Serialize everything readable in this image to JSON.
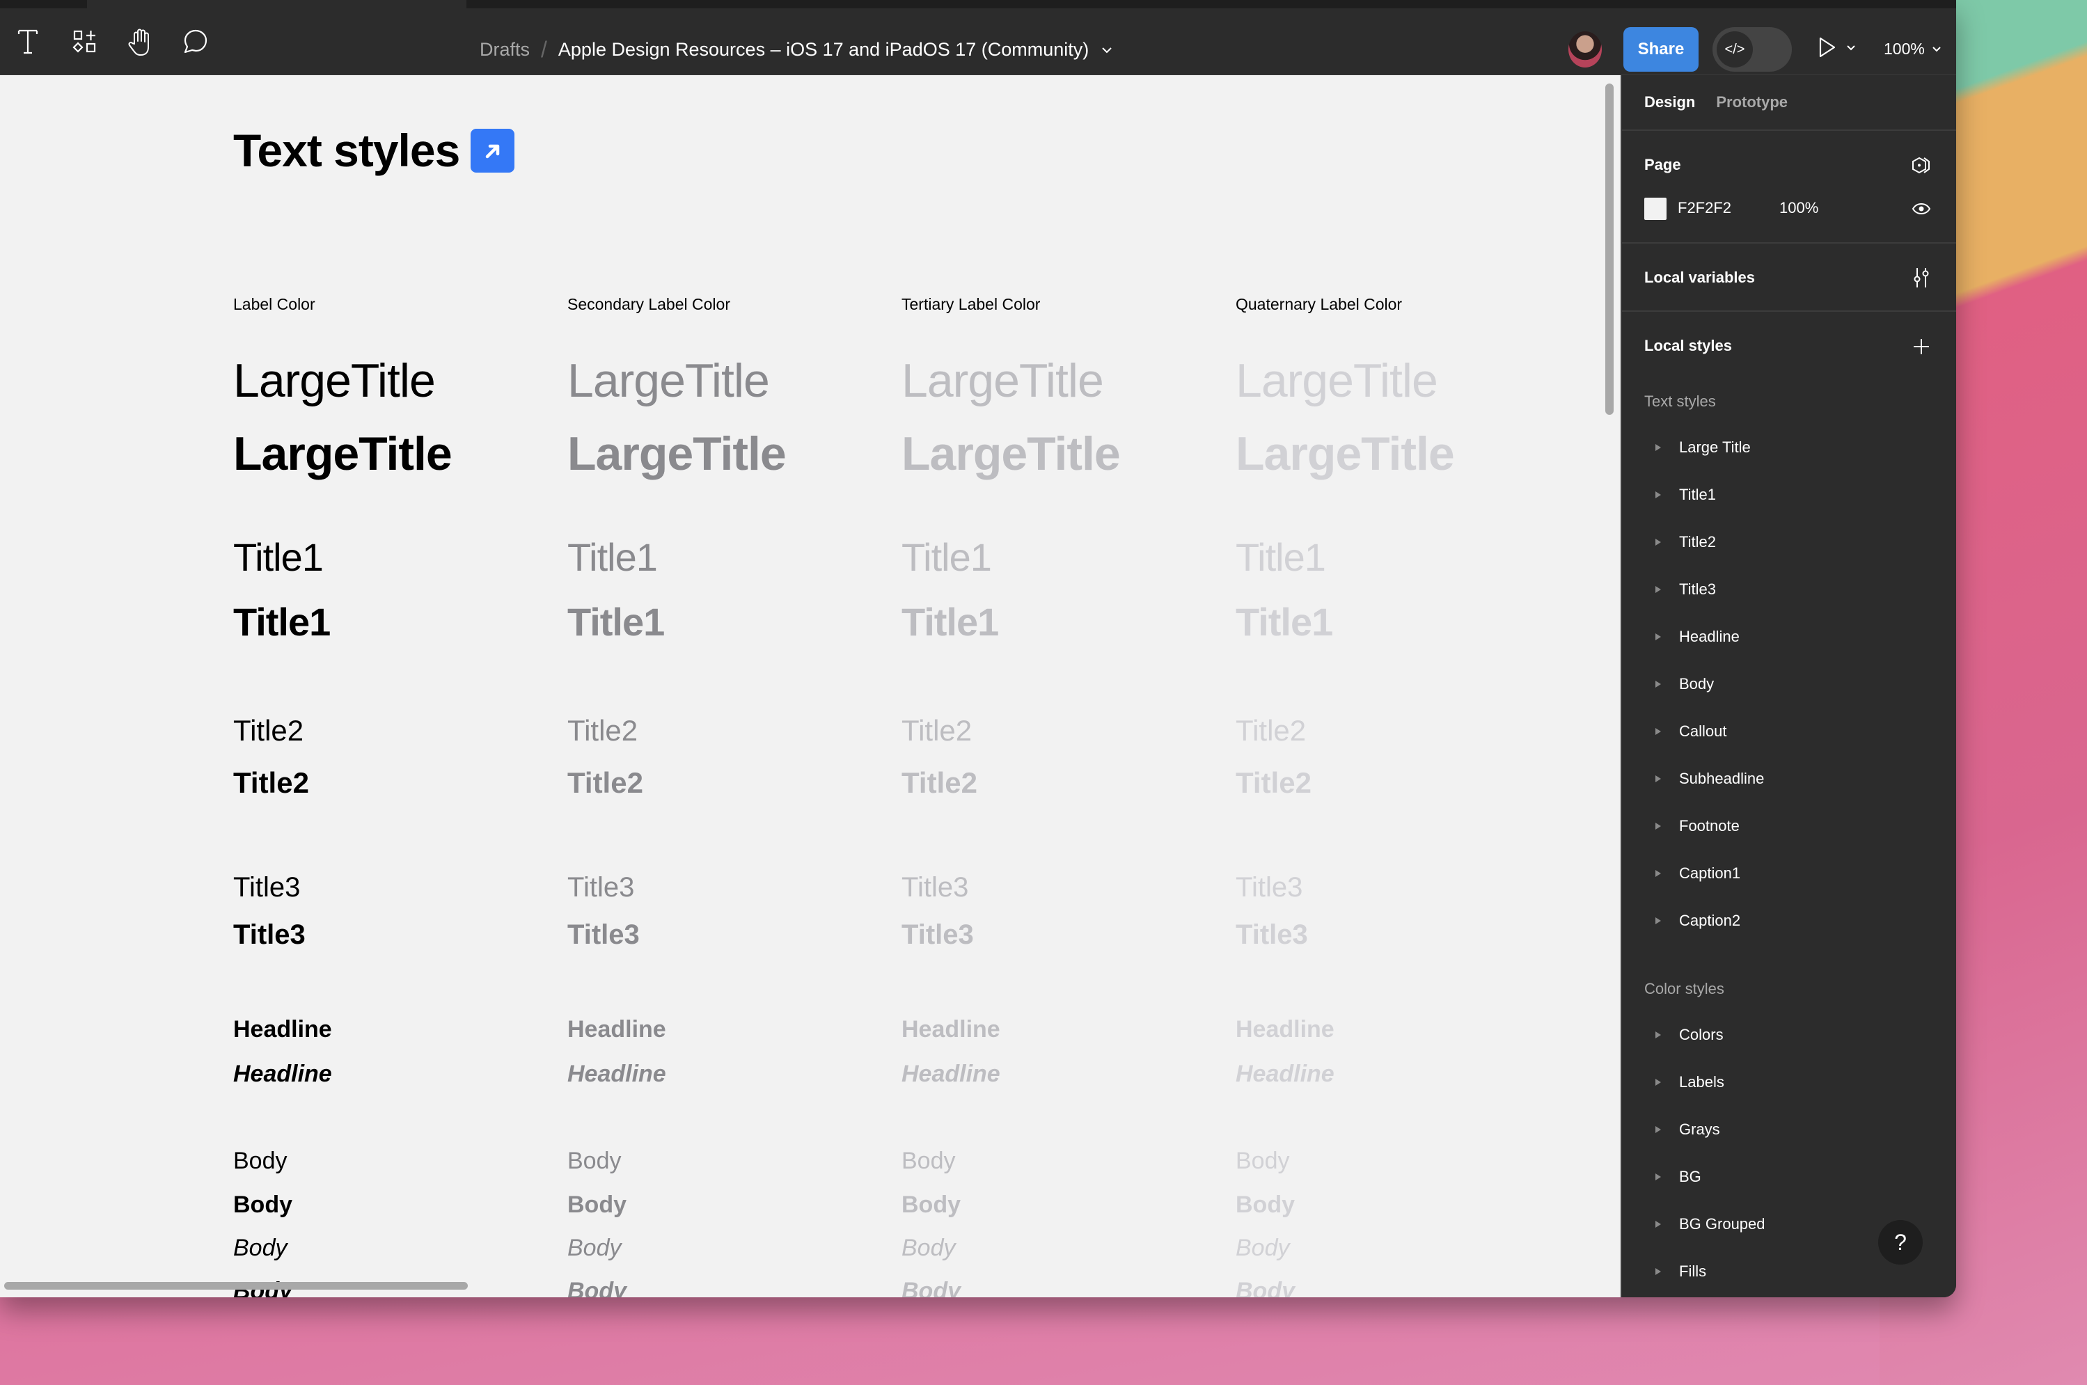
{
  "toolbar": {
    "tools": [
      {
        "name": "text-tool",
        "icon": "text-T-icon"
      },
      {
        "name": "resources-tool",
        "icon": "shapes-plus-icon"
      },
      {
        "name": "hand-tool",
        "icon": "hand-icon"
      },
      {
        "name": "comment-tool",
        "icon": "speech-bubble-icon"
      }
    ],
    "breadcrumb": {
      "parent": "Drafts",
      "separator": "/",
      "file_name": "Apple Design Resources – iOS 17 and iPadOS 17 (Community)"
    },
    "share_label": "Share",
    "dev_mode_glyph": "</>",
    "zoom_level": "100%",
    "accent_color": "#3d86e0"
  },
  "canvas": {
    "background": "#F2F2F2",
    "title": "Text styles",
    "columns": [
      {
        "label": "Label Color",
        "color": "#000000"
      },
      {
        "label": "Secondary Label Color",
        "color": "#8a8a8e"
      },
      {
        "label": "Tertiary Label Color",
        "color": "#bdbdc1"
      },
      {
        "label": "Quaternary Label Color",
        "color": "#d1d1d5"
      }
    ],
    "rows": [
      {
        "text": "LargeTitle",
        "style": "regular"
      },
      {
        "text": "LargeTitle",
        "style": "bold"
      },
      {
        "text": "Title1",
        "style": "regular"
      },
      {
        "text": "Title1",
        "style": "bold"
      },
      {
        "text": "Title2",
        "style": "regular"
      },
      {
        "text": "Title2",
        "style": "bold"
      },
      {
        "text": "Title3",
        "style": "regular"
      },
      {
        "text": "Title3",
        "style": "bold"
      },
      {
        "text": "Headline",
        "style": "semibold"
      },
      {
        "text": "Headline",
        "style": "semibold-italic"
      },
      {
        "text": "Body",
        "style": "regular"
      },
      {
        "text": "Body",
        "style": "semibold"
      },
      {
        "text": "Body",
        "style": "italic"
      },
      {
        "text": "Body",
        "style": "semibold-italic"
      }
    ]
  },
  "panel": {
    "tabs": [
      "Design",
      "Prototype"
    ],
    "active_tab": "Design",
    "page": {
      "title": "Page",
      "fill_hex": "F2F2F2",
      "fill_opacity": "100%"
    },
    "local_variables": "Local variables",
    "local_styles": "Local styles",
    "text_styles_label": "Text styles",
    "text_styles": [
      "Large Title",
      "Title1",
      "Title2",
      "Title3",
      "Headline",
      "Body",
      "Callout",
      "Subheadline",
      "Footnote",
      "Caption1",
      "Caption2"
    ],
    "color_styles_label": "Color styles",
    "color_styles": [
      "Colors",
      "Labels",
      "Grays",
      "BG",
      "BG Grouped",
      "Fills"
    ],
    "help_glyph": "?"
  }
}
